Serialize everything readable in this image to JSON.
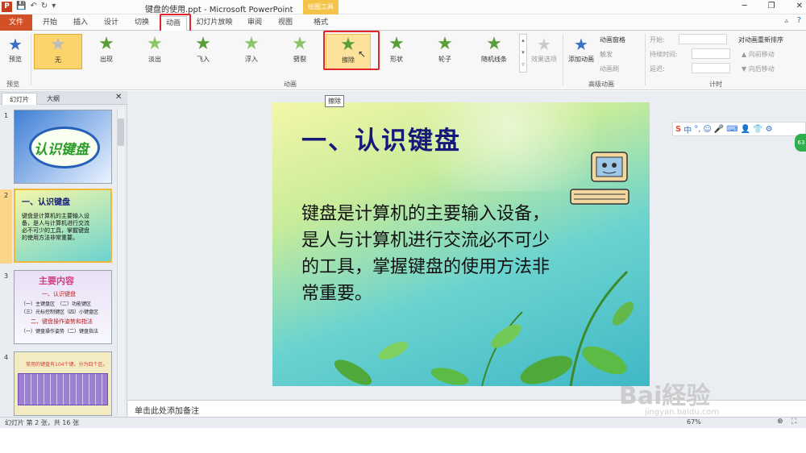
{
  "window": {
    "title": "键盘的使用.ppt - Microsoft PowerPoint",
    "context_tab_group": "绘图工具",
    "app_icon": "P"
  },
  "tabs": [
    "文件",
    "开始",
    "插入",
    "设计",
    "切换",
    "动画",
    "幻灯片放映",
    "审阅",
    "视图",
    "格式"
  ],
  "ribbon": {
    "preview": {
      "label": "预览",
      "group": "预览"
    },
    "animations": [
      {
        "label": "无"
      },
      {
        "label": "出现"
      },
      {
        "label": "淡出"
      },
      {
        "label": "飞入"
      },
      {
        "label": "浮入"
      },
      {
        "label": "劈裂"
      },
      {
        "label": "擦除"
      },
      {
        "label": "形状"
      },
      {
        "label": "轮子"
      },
      {
        "label": "随机线条"
      }
    ],
    "effect_options": "效果选项",
    "animation_group": "动画",
    "advanced": {
      "add_animation": "添加动画",
      "pane": "动画窗格",
      "trigger": "触发",
      "painter": "动画刷",
      "group": "高级动画"
    },
    "timing": {
      "start": "开始:",
      "duration": "持续时间:",
      "delay": "延迟:",
      "reorder": "对动画重新排序",
      "earlier": "向前移动",
      "later": "向后移动",
      "group": "计时"
    }
  },
  "left_panel": {
    "tabs": [
      "幻灯片",
      "大纲"
    ],
    "thumbs": [
      {
        "num": "1",
        "text": "认识键盘"
      },
      {
        "num": "2",
        "text": "一、认识键盘",
        "body": "键盘是计算机的主要输入设备，是人与计算机进行交流必不可少的工具，掌握键盘的使用方法非常重要。"
      },
      {
        "num": "3",
        "text": "主要内容",
        "items": [
          "一、认识键盘",
          "（一）主键盘区　（二）功能键区",
          "（三）光标控制键区（四）小键盘区",
          "二、键盘操作姿势和指法",
          "（一）键盘操作姿势（二）键盘指法"
        ]
      },
      {
        "num": "4",
        "text": "常用的键盘有104个键。分为四个区。"
      }
    ]
  },
  "slide": {
    "title": "一、认识键盘",
    "body": "键盘是计算机的主要输入设备，是人与计算机进行交流必不可少的工具，掌握键盘的使用方法非常重要。"
  },
  "tooltip": "擦除",
  "notes_placeholder": "单击此处添加备注",
  "statusbar": {
    "slide_info": "幻灯片 第 2 张，共 16 张",
    "zoom": "67%"
  },
  "ime": {
    "label": "中"
  },
  "badge": "63",
  "watermark": {
    "brand": "Bai経验",
    "url": "jingyan.baidu.com"
  }
}
